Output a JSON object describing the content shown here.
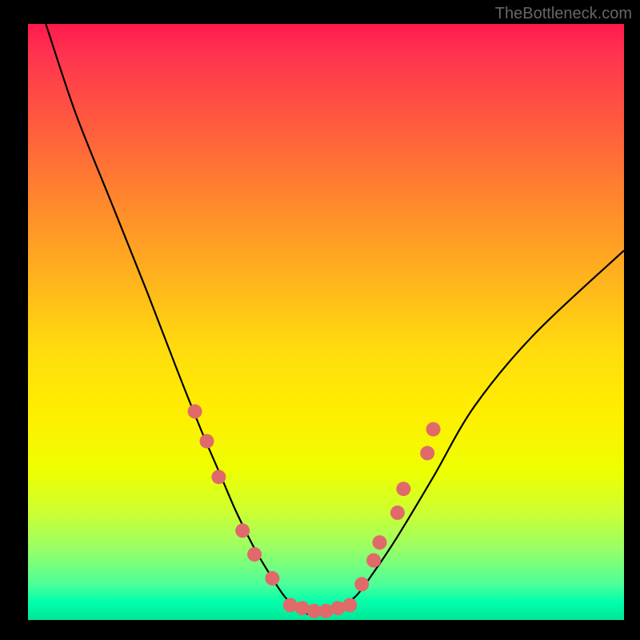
{
  "watermark": "TheBottleneck.com",
  "chart_data": {
    "type": "line",
    "title": "",
    "xlabel": "",
    "ylabel": "",
    "xlim": [
      0,
      100
    ],
    "ylim": [
      0,
      100
    ],
    "grid": false,
    "series": [
      {
        "name": "bottleneck-curve",
        "x": [
          3,
          8,
          14,
          20,
          25,
          29,
          32,
          35,
          38,
          41,
          43,
          45,
          47,
          49,
          52,
          55,
          58,
          62,
          68,
          75,
          85,
          100
        ],
        "y": [
          100,
          85,
          70,
          55,
          42,
          32,
          25,
          18,
          12,
          7,
          4,
          2,
          1,
          1,
          2,
          4,
          8,
          14,
          24,
          36,
          48,
          62
        ]
      }
    ],
    "markers": [
      {
        "name": "left-1",
        "x": 28,
        "y": 35
      },
      {
        "name": "left-2",
        "x": 30,
        "y": 30
      },
      {
        "name": "left-3",
        "x": 32,
        "y": 24
      },
      {
        "name": "left-4",
        "x": 36,
        "y": 15
      },
      {
        "name": "left-5",
        "x": 38,
        "y": 11
      },
      {
        "name": "left-6",
        "x": 41,
        "y": 7
      },
      {
        "name": "bottom-1",
        "x": 44,
        "y": 2.5
      },
      {
        "name": "bottom-2",
        "x": 46,
        "y": 2
      },
      {
        "name": "bottom-3",
        "x": 48,
        "y": 1.5
      },
      {
        "name": "bottom-4",
        "x": 50,
        "y": 1.5
      },
      {
        "name": "bottom-5",
        "x": 52,
        "y": 2
      },
      {
        "name": "bottom-6",
        "x": 54,
        "y": 2.5
      },
      {
        "name": "right-1",
        "x": 56,
        "y": 6
      },
      {
        "name": "right-2",
        "x": 58,
        "y": 10
      },
      {
        "name": "right-3",
        "x": 59,
        "y": 13
      },
      {
        "name": "right-4",
        "x": 62,
        "y": 18
      },
      {
        "name": "right-5",
        "x": 63,
        "y": 22
      },
      {
        "name": "right-6",
        "x": 67,
        "y": 28
      },
      {
        "name": "right-7",
        "x": 68,
        "y": 32
      }
    ],
    "marker_style": {
      "color": "#e06a6a",
      "radius_px": 9
    },
    "colors": {
      "background": "#000000",
      "gradient_top": "#ff1a4d",
      "gradient_bottom": "#00e699",
      "curve": "#000000"
    }
  }
}
